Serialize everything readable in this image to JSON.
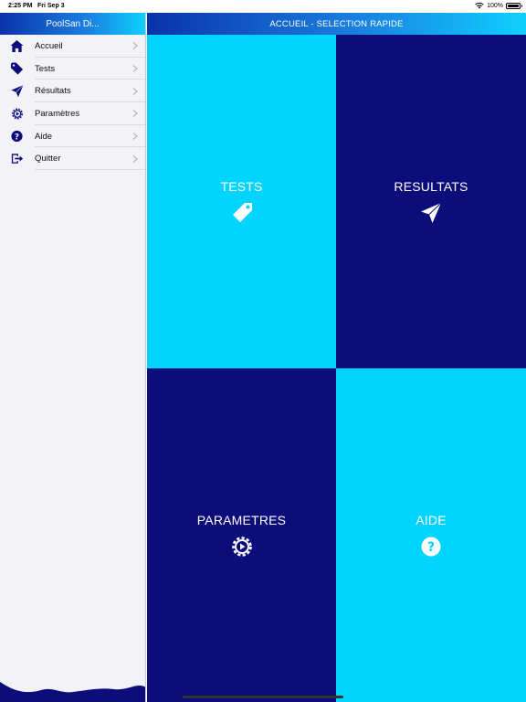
{
  "status_bar": {
    "time": "2:25 PM",
    "date": "Fri Sep 3",
    "battery": "100%",
    "battery_level": 1.0
  },
  "sidebar": {
    "title": "PoolSan Di...",
    "items": [
      {
        "label": "Accueil",
        "icon": "home-icon"
      },
      {
        "label": "Tests",
        "icon": "tag-icon"
      },
      {
        "label": "Résultats",
        "icon": "paper-plane-icon"
      },
      {
        "label": "Paramètres",
        "icon": "gear-icon"
      },
      {
        "label": "Aide",
        "icon": "question-icon"
      },
      {
        "label": "Quitter",
        "icon": "exit-icon"
      }
    ]
  },
  "header": {
    "title": "ACCUEIL - SELECTION RAPIDE"
  },
  "tiles": [
    {
      "label": "TESTS",
      "icon": "tag-icon",
      "color": "#00d4ff"
    },
    {
      "label": "RESULTATS",
      "icon": "paper-plane-icon",
      "color": "#0c0c7a"
    },
    {
      "label": "PARAMETRES",
      "icon": "gear-icon",
      "color": "#0c0c7a"
    },
    {
      "label": "AIDE",
      "icon": "question-icon",
      "color": "#00d4ff"
    }
  ],
  "colors": {
    "accent_light": "#00d4ff",
    "accent_dark": "#0c0c7a",
    "icon_color": "#0c0c7a",
    "sidebar_bg": "#f2f2f7"
  }
}
